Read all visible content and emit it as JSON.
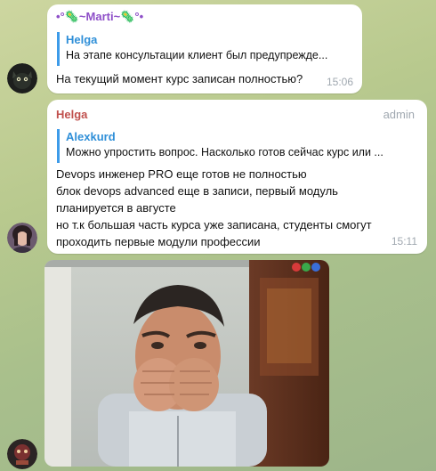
{
  "messages": [
    {
      "sender": "•°🦠~Marti~🦠°•",
      "reply": {
        "author": "Helga",
        "text": "На этапе консультации клиент был предупрежде..."
      },
      "text": "На текущий момент курс записан полностью?",
      "time": "15:06"
    },
    {
      "sender": "Helga",
      "badge": "admin",
      "reply": {
        "author": "Alexkurd",
        "text": "Можно упростить вопрос. Насколько готов сейчас курс или ..."
      },
      "lines": [
        "Devops инженер PRO  еще готов не полностью",
        "блок devops advanced  еще в записи, первый модуль",
        "планируется в августе",
        "но т.к большая часть курса уже записана, студенты смогут",
        "проходить первые модули  профессии"
      ],
      "time": "15:11"
    }
  ],
  "colors": {
    "marti_name": "#8e4fc8",
    "helga_name": "#c0504d",
    "reply_bar": "#3d9be9",
    "time": "#a0a8b0"
  }
}
